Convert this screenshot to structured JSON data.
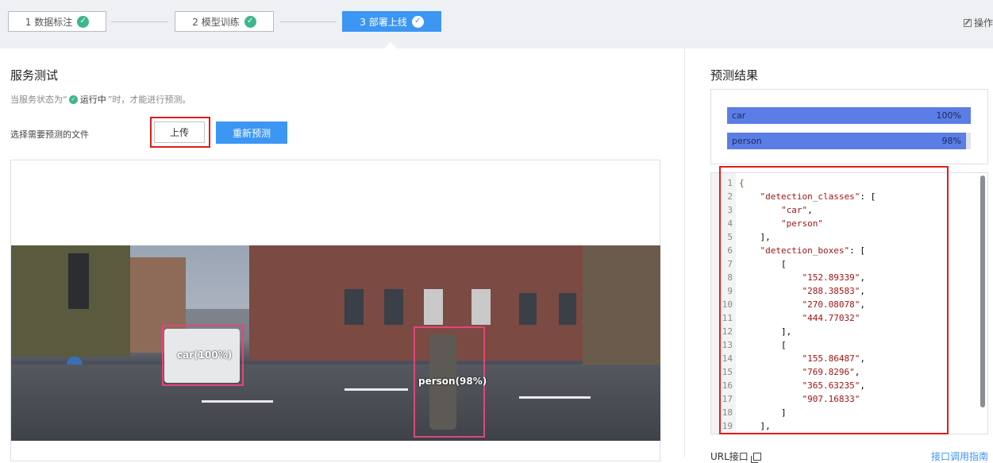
{
  "steps": [
    {
      "label": "1 数据标注",
      "state": "done"
    },
    {
      "label": "2 模型训练",
      "state": "done"
    },
    {
      "label": "3 部署上线",
      "state": "active"
    }
  ],
  "header": {
    "ops_label": "操作"
  },
  "service_test": {
    "title": "服务测试",
    "hint_prefix": "当服务状态为“",
    "hint_status": "运行中",
    "hint_suffix": "”时，才能进行预测。",
    "file_label": "选择需要预测的文件",
    "upload_label": "上传",
    "repredict_label": "重新预测"
  },
  "detections": [
    {
      "label": "car(100%)"
    },
    {
      "label": "person(98%)"
    }
  ],
  "prediction": {
    "title": "预测结果",
    "bars": [
      {
        "name": "car",
        "pct_text": "100%",
        "value": 1.0
      },
      {
        "name": "person",
        "pct_text": "98%",
        "value": 0.98
      }
    ]
  },
  "code_lines": [
    "{",
    "    \"detection_classes\": [",
    "        \"car\",",
    "        \"person\"",
    "    ],",
    "    \"detection_boxes\": [",
    "        [",
    "            \"152.89339\",",
    "            \"288.38583\",",
    "            \"270.08078\",",
    "            \"444.77032\"",
    "        ],",
    "        [",
    "            \"155.86487\",",
    "            \"769.8296\",",
    "            \"365.63235\",",
    "            \"907.16833\"",
    "        ]",
    "    ],"
  ],
  "footer": {
    "url_label": "URL接口",
    "guide_label": "接口调用指南"
  },
  "colors": {
    "primary": "#3b96f4",
    "success": "#3fb68b",
    "highlight": "#e01b1b",
    "bar": "#5b7de6",
    "box": "#e0467a"
  },
  "icons": [
    "check-icon",
    "edit-icon",
    "copy-icon"
  ]
}
